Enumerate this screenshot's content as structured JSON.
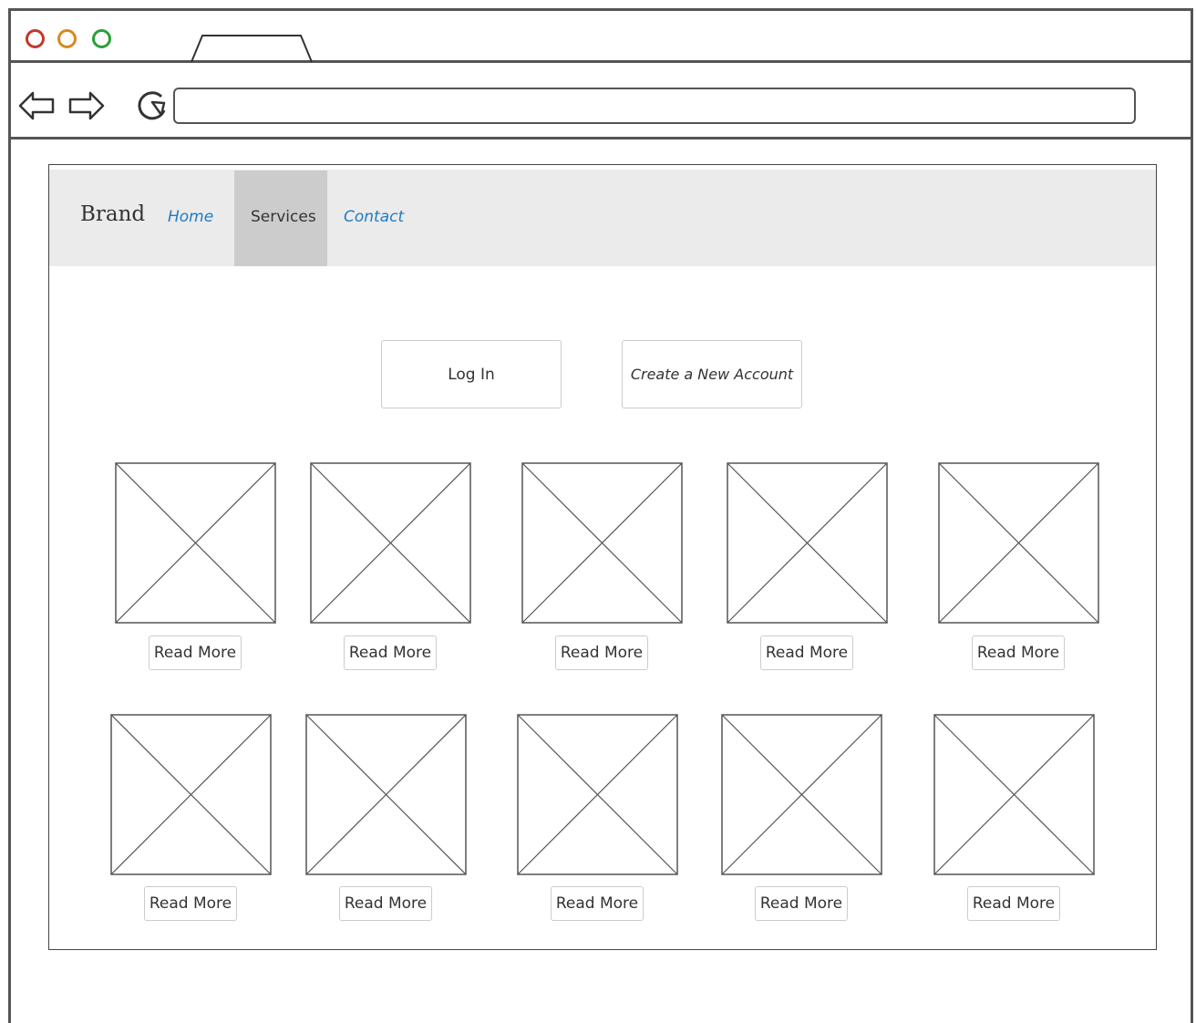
{
  "browser": {
    "controls": [
      "close-dot",
      "minimize-dot",
      "maximize-dot"
    ],
    "url": ""
  },
  "navbar": {
    "brand": "Brand",
    "links": [
      "Home",
      "Services",
      "Contact"
    ],
    "active": "Services"
  },
  "actions": {
    "login_label": "Log In",
    "create_label": "Create a New Account"
  },
  "cards": {
    "read_more": "Read More",
    "rows": 2,
    "per_row": 5
  },
  "colors": {
    "link": "#1f7bc2",
    "navbar_bg": "#ebebeb",
    "active_bg": "#cccccc",
    "close": "#c0392b",
    "minimize": "#d78a1e",
    "maximize": "#27a036"
  }
}
